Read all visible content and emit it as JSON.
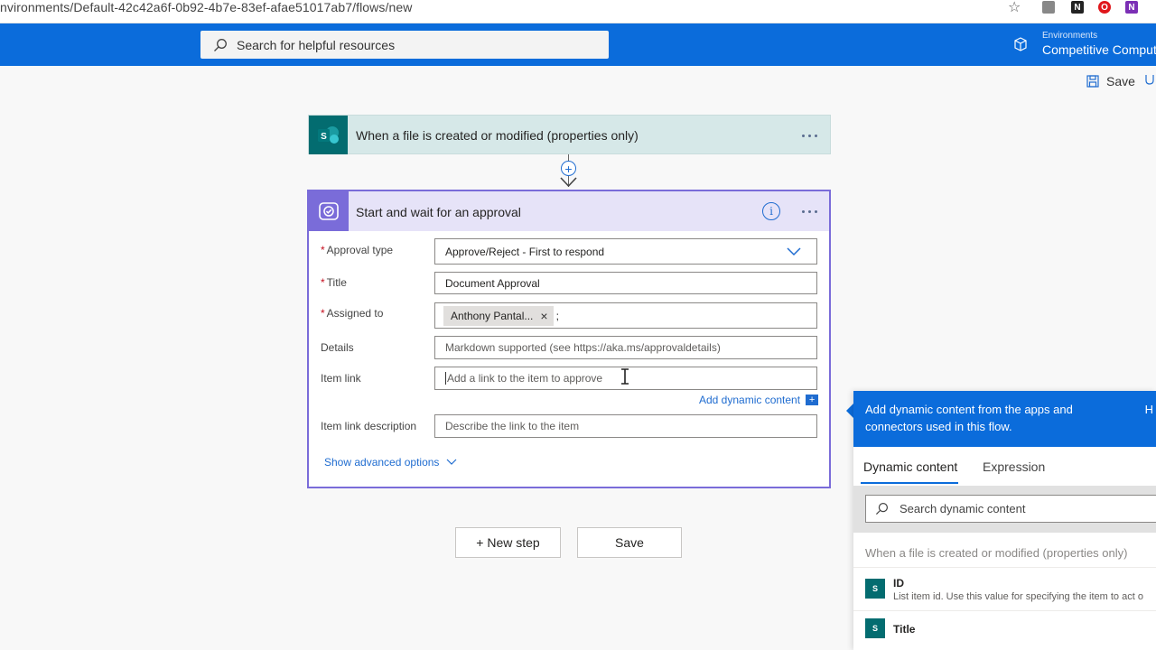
{
  "browser": {
    "url": "nvironments/Default-42c42a6f-0b92-4b7e-83ef-afae51017ab7/flows/new"
  },
  "header": {
    "search_placeholder": "Search for helpful resources",
    "environments_caption": "Environments",
    "environment_name": "Competitive Computi"
  },
  "commandbar": {
    "save_label": "Save"
  },
  "trigger": {
    "title": "When a file is created or modified (properties only)",
    "icon_letter": "S"
  },
  "approval": {
    "title": "Start and wait for an approval",
    "fields": {
      "approval_type": {
        "label": "Approval type",
        "required": "*",
        "value": "Approve/Reject - First to respond"
      },
      "title": {
        "label": "Title",
        "required": "*",
        "value": "Document Approval"
      },
      "assigned_to": {
        "label": "Assigned to",
        "required": "*",
        "chip": "Anthony Pantal...",
        "chip_remove": "×",
        "separator": ";"
      },
      "details": {
        "label": "Details",
        "placeholder": "Markdown supported (see https://aka.ms/approvaldetails)"
      },
      "item_link": {
        "label": "Item link",
        "placeholder": "Add a link to the item to approve"
      },
      "item_link_description": {
        "label": "Item link description",
        "placeholder": "Describe the link to the item"
      }
    },
    "add_dynamic_content": "Add dynamic content",
    "show_advanced": "Show advanced options"
  },
  "actions": {
    "new_step": "+ New step",
    "save": "Save"
  },
  "dynamic_panel": {
    "header": "Add dynamic content from the apps and connectors used in this flow.",
    "close": "H",
    "tabs": [
      "Dynamic content",
      "Expression"
    ],
    "search_placeholder": "Search dynamic content",
    "section": "When a file is created or modified (properties only)",
    "items": [
      {
        "title": "ID",
        "desc": "List item id. Use this value for specifying the item to act o"
      },
      {
        "title": "Title",
        "desc": ""
      }
    ]
  },
  "colors": {
    "brand_blue": "#0b6cdb",
    "approval_purple": "#7a6cd9",
    "sharepoint_teal": "#036c70"
  }
}
